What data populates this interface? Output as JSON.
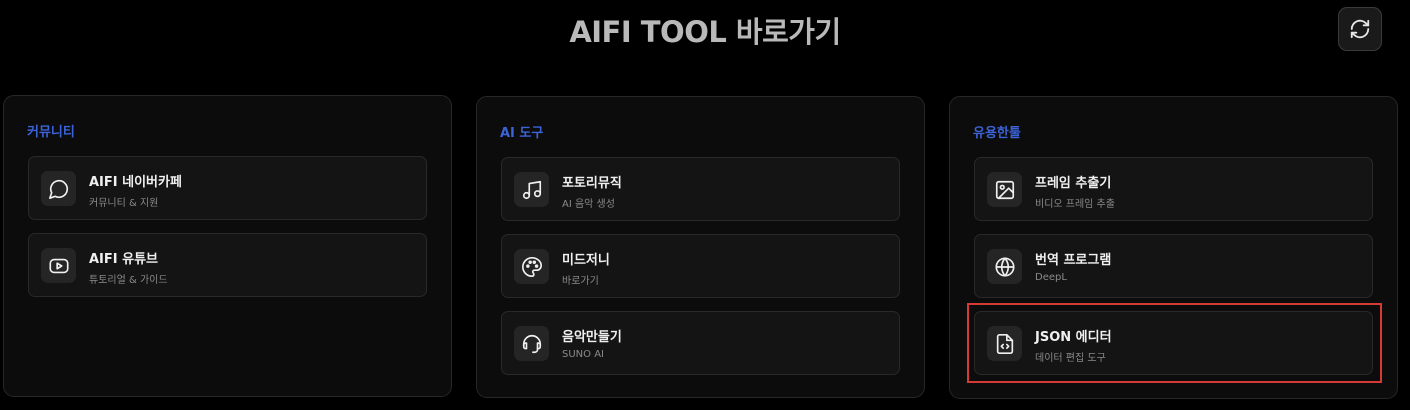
{
  "header": {
    "title": "AIFI TOOL 바로가기"
  },
  "panels": [
    {
      "title": "커뮤니티",
      "items": [
        {
          "title": "AIFI 네이버카페",
          "subtitle": "커뮤니티 & 지원",
          "icon": "chat-bubble-icon"
        },
        {
          "title": "AIFI 유튜브",
          "subtitle": "튜토리얼 & 가이드",
          "icon": "youtube-play-icon"
        }
      ]
    },
    {
      "title": "AI 도구",
      "items": [
        {
          "title": "포토리뮤직",
          "subtitle": "AI 음악 생성",
          "icon": "music-note-icon"
        },
        {
          "title": "미드저니",
          "subtitle": "바로가기",
          "icon": "palette-icon"
        },
        {
          "title": "음악만들기",
          "subtitle": "SUNO AI",
          "icon": "headphones-icon"
        }
      ]
    },
    {
      "title": "유용한툴",
      "items": [
        {
          "title": "프레임 추출기",
          "subtitle": "비디오 프레임 추출",
          "icon": "image-icon"
        },
        {
          "title": "번역 프로그램",
          "subtitle": "DeepL",
          "icon": "globe-icon"
        },
        {
          "title": "JSON 에디터",
          "subtitle": "데이터 편집 도구",
          "icon": "code-file-icon"
        }
      ]
    }
  ],
  "colors": {
    "background": "#000000",
    "section_title": "#3c63d8",
    "highlight_border": "#d63a37"
  }
}
